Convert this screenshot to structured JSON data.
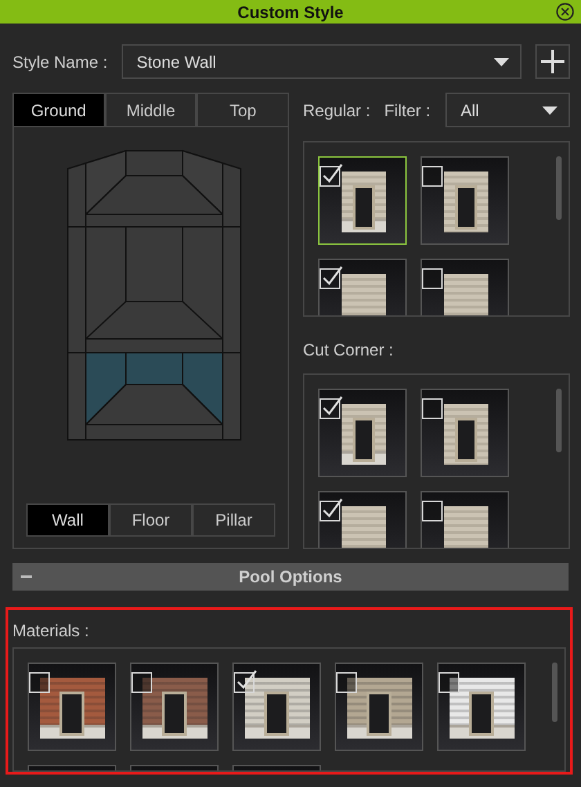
{
  "window": {
    "title": "Custom Style"
  },
  "style_name": {
    "label": "Style Name :",
    "value": "Stone Wall"
  },
  "level_tabs": [
    {
      "label": "Ground",
      "selected": true
    },
    {
      "label": "Middle",
      "selected": false
    },
    {
      "label": "Top",
      "selected": false
    }
  ],
  "part_tabs": [
    {
      "label": "Wall",
      "selected": true
    },
    {
      "label": "Floor",
      "selected": false
    },
    {
      "label": "Pillar",
      "selected": false
    }
  ],
  "regular": {
    "label": "Regular :",
    "filter_label": "Filter :",
    "filter_value": "All",
    "tiles": [
      {
        "kind": "door-base",
        "checked": true,
        "selected": true
      },
      {
        "kind": "door",
        "checked": false,
        "selected": false
      },
      {
        "kind": "plain",
        "checked": true,
        "selected": false
      },
      {
        "kind": "plain",
        "checked": false,
        "selected": false
      }
    ]
  },
  "cut_corner": {
    "label": "Cut Corner :",
    "tiles": [
      {
        "kind": "door-base",
        "checked": true,
        "selected": false
      },
      {
        "kind": "door",
        "checked": false,
        "selected": false
      },
      {
        "kind": "plain",
        "checked": true,
        "selected": false
      },
      {
        "kind": "plain",
        "checked": false,
        "selected": false
      }
    ]
  },
  "pool_options": {
    "label": "Pool Options",
    "expanded": true
  },
  "materials": {
    "label": "Materials :",
    "highlighted": true,
    "tiles": [
      {
        "kind": "door-base",
        "checked": false,
        "selected": false,
        "color": "#a45a3e"
      },
      {
        "kind": "door-base",
        "checked": false,
        "selected": false,
        "color": "#8a5c4a"
      },
      {
        "kind": "door-base",
        "checked": true,
        "selected": false,
        "color": "#d2cec4"
      },
      {
        "kind": "door-base",
        "checked": false,
        "selected": false,
        "color": "#b3a792"
      },
      {
        "kind": "door-base",
        "checked": false,
        "selected": false,
        "color": "#e8e8e8"
      },
      {
        "kind": "blank"
      },
      {
        "kind": "blank"
      },
      {
        "kind": "blank"
      }
    ]
  }
}
